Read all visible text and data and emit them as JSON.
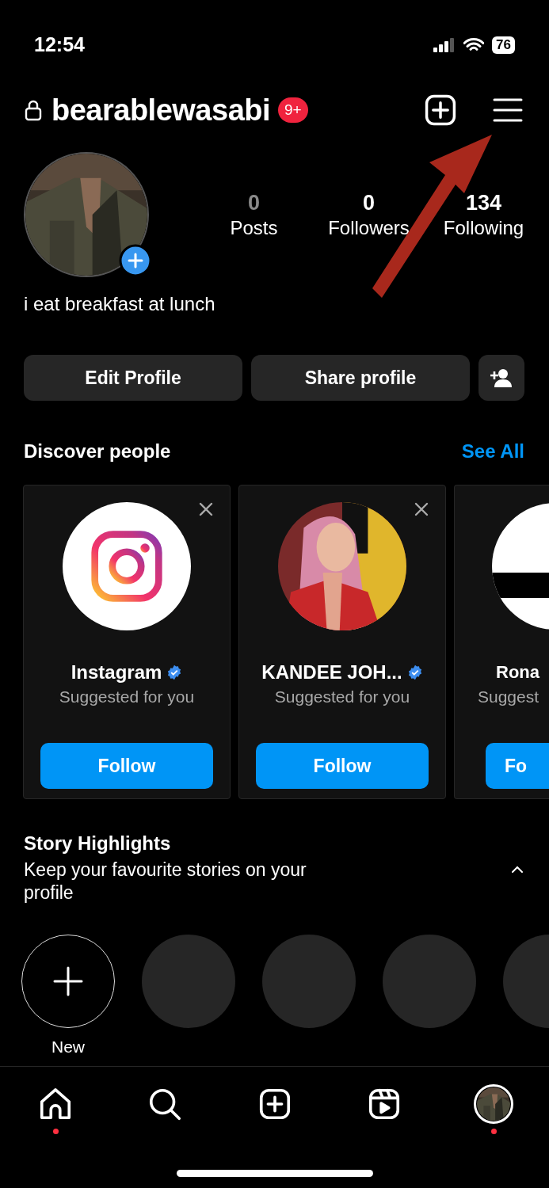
{
  "status_bar": {
    "time": "12:54",
    "battery": "76"
  },
  "header": {
    "username": "bearablewasabi",
    "badge": "9+"
  },
  "profile": {
    "stats": [
      {
        "value": "0",
        "label": "Posts",
        "dimmed": true
      },
      {
        "value": "0",
        "label": "Followers",
        "dimmed": false
      },
      {
        "value": "134",
        "label": "Following",
        "dimmed": false
      }
    ],
    "bio": "i eat breakfast at lunch"
  },
  "buttons": [
    "Edit Profile",
    "Share profile"
  ],
  "discover": {
    "title": "Discover people",
    "see_all": "See All",
    "cards": [
      {
        "kind": "logo",
        "name": "Instagram",
        "verified": true,
        "subtitle": "Suggested for you",
        "follow": "Follow",
        "dismissable": true
      },
      {
        "kind": "picture",
        "name": "KANDEE JOH...",
        "verified": true,
        "subtitle": "Suggested for you",
        "follow": "Follow",
        "dismissable": true
      },
      {
        "kind": "partial",
        "name": "Rona",
        "verified": false,
        "subtitle": "Suggest",
        "follow": "Fo",
        "dismissable": false
      }
    ]
  },
  "highlights": {
    "title": "Story Highlights",
    "subtitle": "Keep your favourite stories on your profile",
    "expanded": true,
    "items": [
      {
        "kind": "new",
        "label": "New"
      },
      {
        "kind": "empty"
      },
      {
        "kind": "empty"
      },
      {
        "kind": "empty"
      },
      {
        "kind": "empty"
      }
    ]
  },
  "nav": {
    "items": [
      {
        "kind": "home",
        "dot": true,
        "selected": false
      },
      {
        "kind": "search",
        "dot": false,
        "selected": false
      },
      {
        "kind": "create",
        "dot": false,
        "selected": false
      },
      {
        "kind": "reels",
        "dot": false,
        "selected": false
      },
      {
        "kind": "profile",
        "dot": true,
        "selected": true
      }
    ]
  }
}
